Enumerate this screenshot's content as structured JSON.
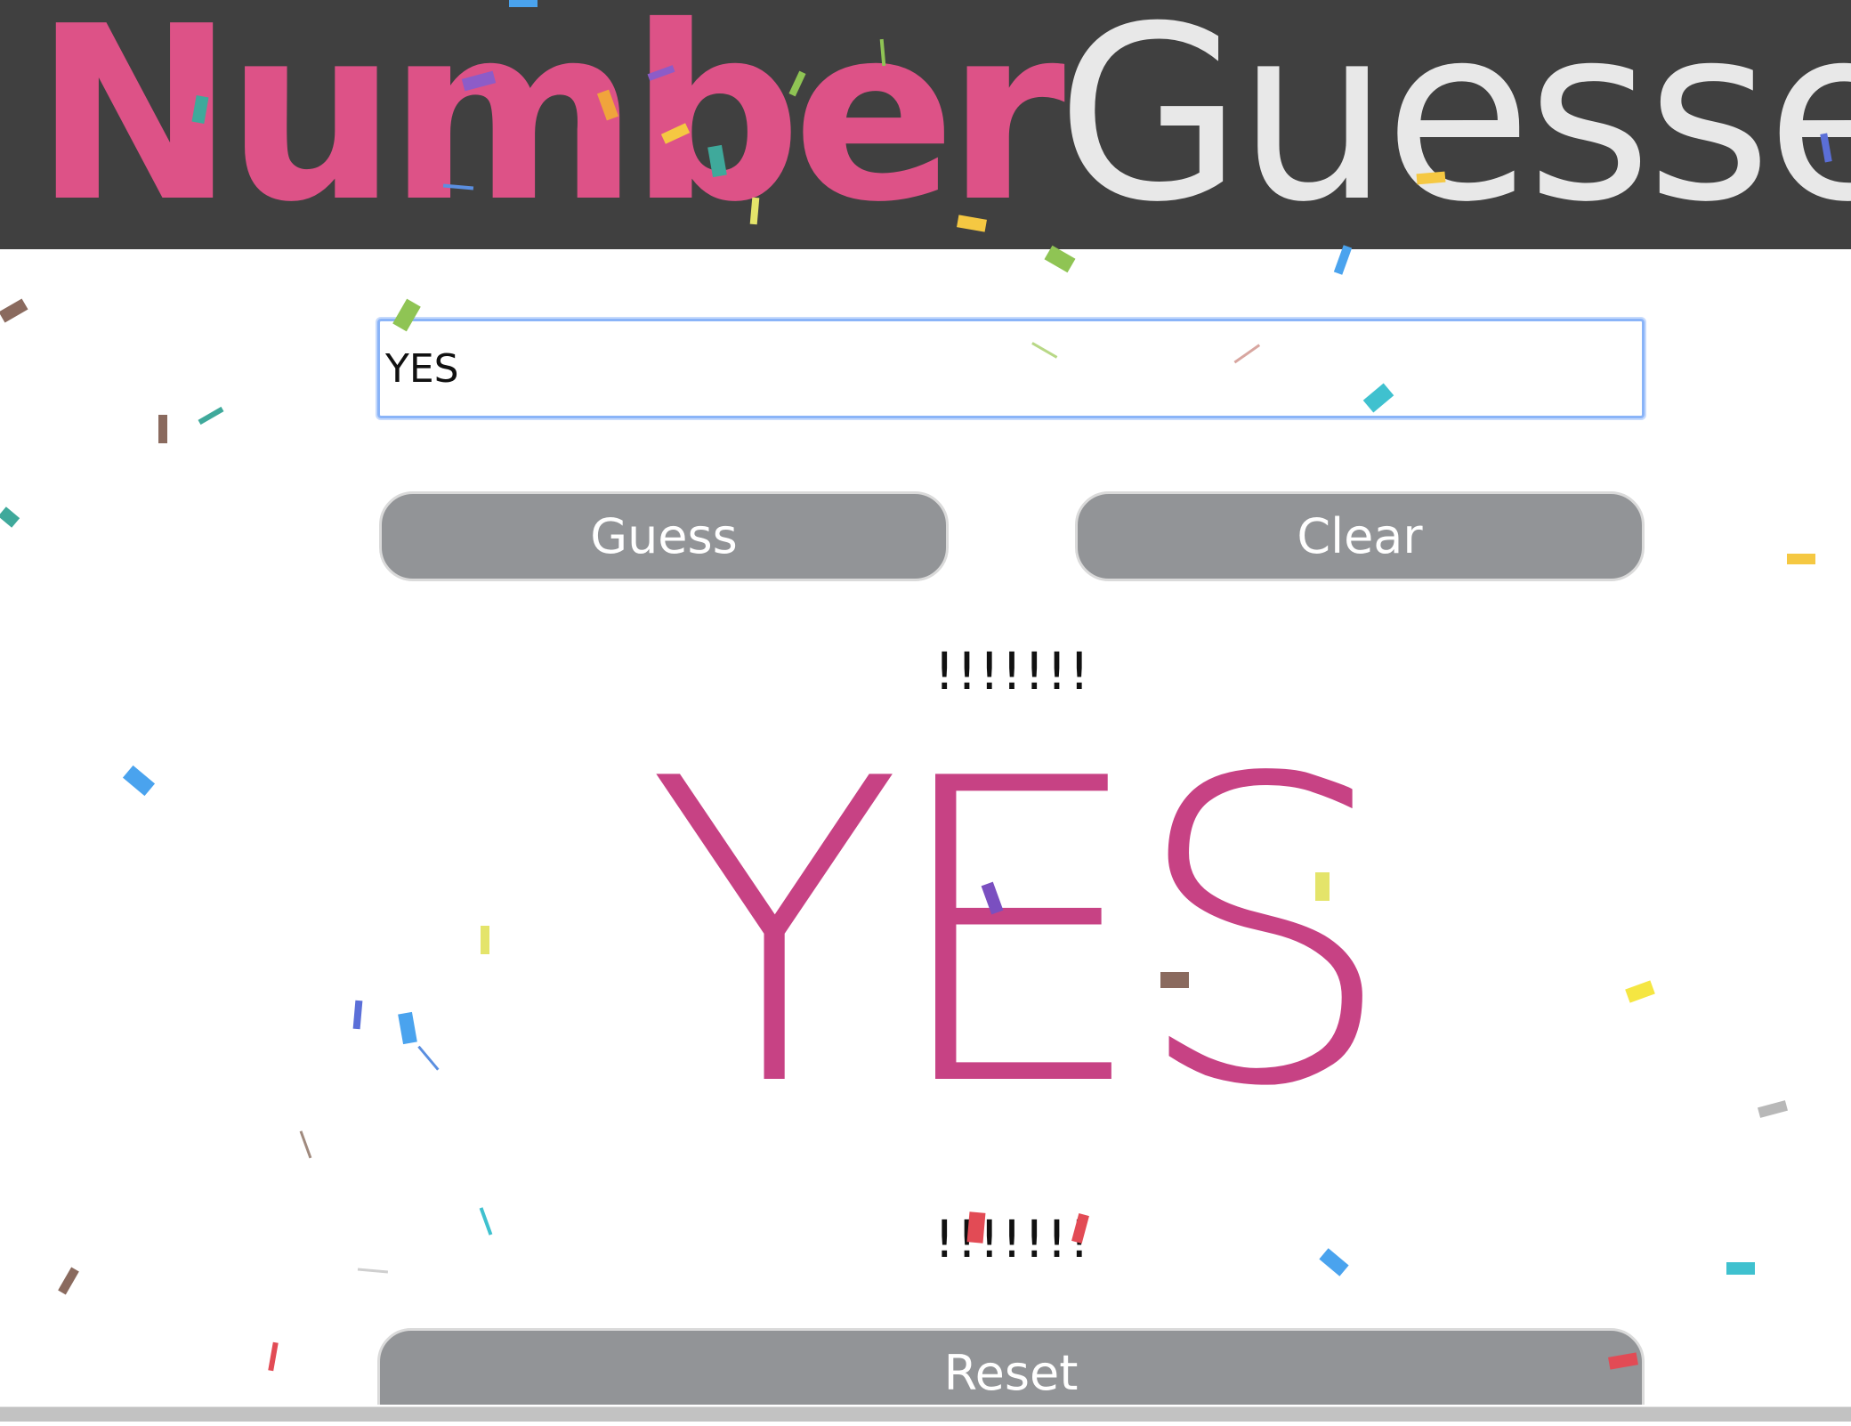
{
  "header": {
    "title_part1": "Number",
    "title_part2": "Guesser"
  },
  "guess_input": {
    "value": "YES",
    "placeholder": ""
  },
  "buttons": {
    "guess_label": "Guess",
    "clear_label": "Clear",
    "reset_label": "Reset"
  },
  "result": {
    "top_text": "!!!!!!!",
    "main_text": "YES",
    "bottom_text": "!!!!!!!"
  },
  "colors": {
    "header_bg": "#404040",
    "title_accent": "#dd5287",
    "title_light": "#e8e8e8",
    "result_text": "#c74284",
    "button_bg": "#929497",
    "input_focus": "#8ab4f8"
  }
}
